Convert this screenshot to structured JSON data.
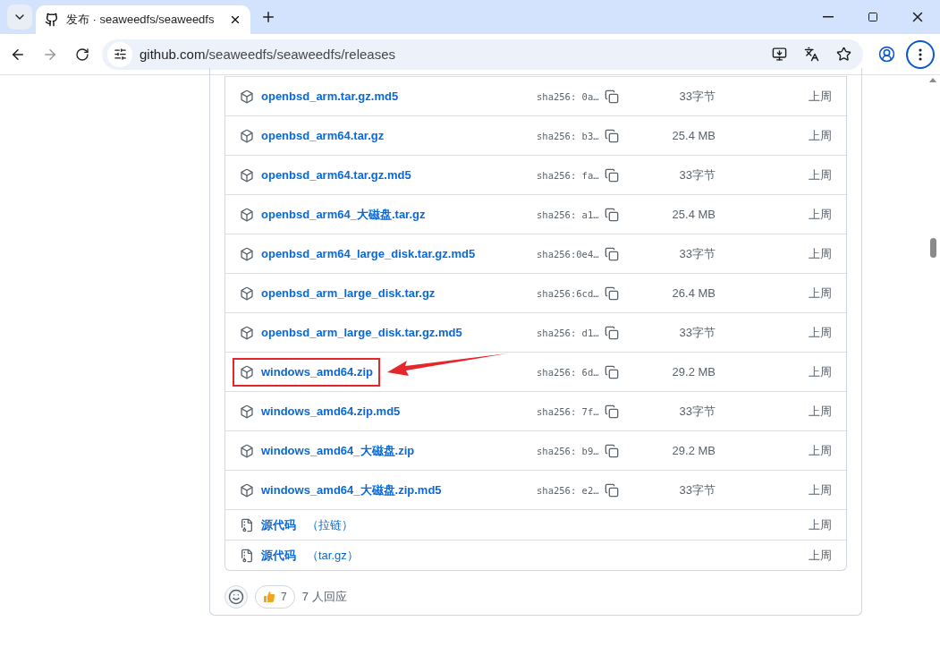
{
  "browser": {
    "tab_title": "发布 · seaweedfs/seaweedfs",
    "url_host": "github.com",
    "url_path": "/seaweedfs/seaweedfs/releases"
  },
  "assets": [
    {
      "kind": "file",
      "name": "openbsd_arm.tar.gz.md5",
      "sha": "sha256: 0a…",
      "size": "33字节",
      "date": "上周",
      "highlighted": false
    },
    {
      "kind": "file",
      "name": "openbsd_arm64.tar.gz",
      "sha": "sha256: b3…",
      "size": "25.4 MB",
      "date": "上周",
      "highlighted": false
    },
    {
      "kind": "file",
      "name": "openbsd_arm64.tar.gz.md5",
      "sha": "sha256: fa…",
      "size": "33字节",
      "date": "上周",
      "highlighted": false
    },
    {
      "kind": "file",
      "name": "openbsd_arm64_**大磁盘**.tar.gz",
      "sha": "sha256: a1…",
      "size": "25.4 MB",
      "date": "上周",
      "highlighted": false
    },
    {
      "kind": "file",
      "name": "openbsd_arm64_large_disk.tar.gz.md5",
      "sha": "sha256:0e4…",
      "size": "33字节",
      "date": "上周",
      "highlighted": false
    },
    {
      "kind": "file",
      "name": "openbsd_arm_large_disk.tar.gz",
      "sha": "sha256:6cd…",
      "size": "26.4 MB",
      "date": "上周",
      "highlighted": false
    },
    {
      "kind": "file",
      "name": "openbsd_arm_large_disk.tar.gz.md5",
      "sha": "sha256: d1…",
      "size": "33字节",
      "date": "上周",
      "highlighted": false
    },
    {
      "kind": "file",
      "name": "windows_amd64.zip",
      "sha": "sha256: 6d…",
      "size": "29.2 MB",
      "date": "上周",
      "highlighted": true
    },
    {
      "kind": "file",
      "name": "windows_amd64.zip.md5",
      "sha": "sha256: 7f…",
      "size": "33字节",
      "date": "上周",
      "highlighted": false
    },
    {
      "kind": "file",
      "name": "windows_amd64_**大磁盘**.zip",
      "sha": "sha256: b9…",
      "size": "29.2 MB",
      "date": "上周",
      "highlighted": false
    },
    {
      "kind": "file",
      "name": "windows_amd64_**大磁盘**.zip.md5",
      "sha": "sha256: e2…",
      "size": "33字节",
      "date": "上周",
      "highlighted": false
    },
    {
      "kind": "source",
      "name": "源代码",
      "format": "（拉链）",
      "date": "上周"
    },
    {
      "kind": "source",
      "name": "源代码",
      "format": "（tar.gz）",
      "date": "上周"
    }
  ],
  "reactions": {
    "thumbs_count": "7",
    "summary": "7 人回应"
  }
}
